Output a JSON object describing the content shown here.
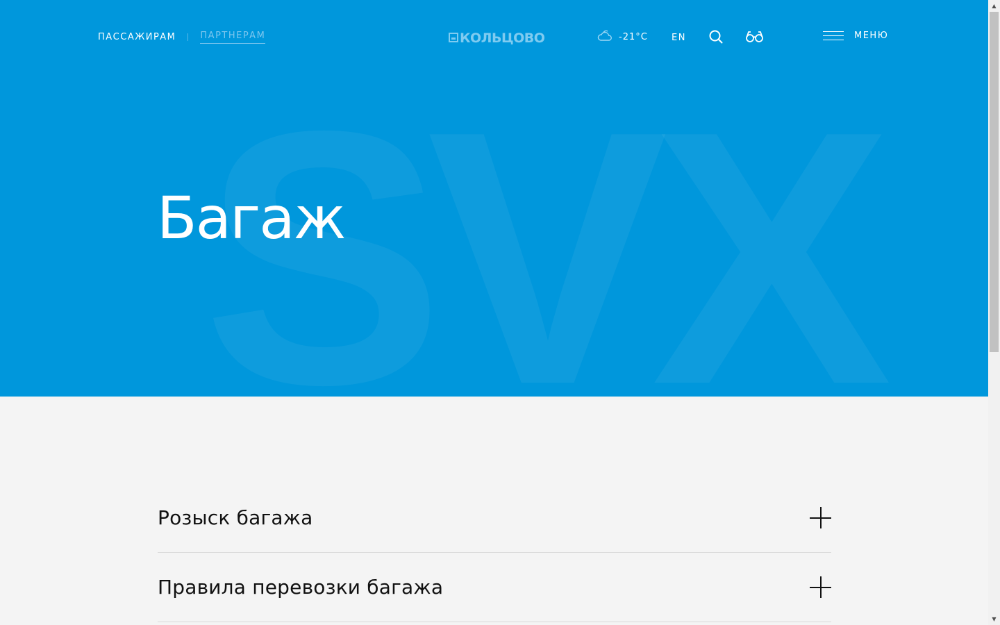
{
  "header": {
    "nav": [
      {
        "label": "ПАССАЖИРАМ"
      },
      {
        "label": "ПАРТНЕРАМ"
      }
    ],
    "logo_text": "КОЛЬЦОВО",
    "weather": {
      "icon": "cloud-icon",
      "temperature": "-21°C"
    },
    "language": "EN",
    "search_icon": "search-icon",
    "accessibility_icon": "glasses-icon",
    "menu_label": "МЕНЮ"
  },
  "hero": {
    "watermark": "SVX",
    "title": "Багаж",
    "background_color": "#0097dc"
  },
  "accordion": {
    "items": [
      {
        "title": "Розыск багажа",
        "icon": "plus-icon"
      },
      {
        "title": "Правила перевозки багажа",
        "icon": "plus-icon"
      }
    ]
  }
}
